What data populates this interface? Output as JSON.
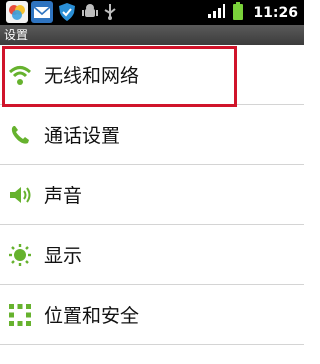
{
  "status_bar": {
    "time": "11:26",
    "icons": [
      "app-icon",
      "mail-icon",
      "shield-icon",
      "android-debug-icon",
      "usb-icon",
      "signal-icon",
      "battery-icon"
    ]
  },
  "title_bar": {
    "title": "设置"
  },
  "menu": {
    "items": [
      {
        "label": "无线和网络",
        "icon": "wifi-icon"
      },
      {
        "label": "通话设置",
        "icon": "phone-icon"
      },
      {
        "label": "声音",
        "icon": "speaker-icon"
      },
      {
        "label": "显示",
        "icon": "brightness-icon"
      },
      {
        "label": "位置和安全",
        "icon": "pattern-lock-icon"
      }
    ]
  },
  "colors": {
    "accent_green": "#66b22e",
    "highlight_red": "#d0142a"
  }
}
